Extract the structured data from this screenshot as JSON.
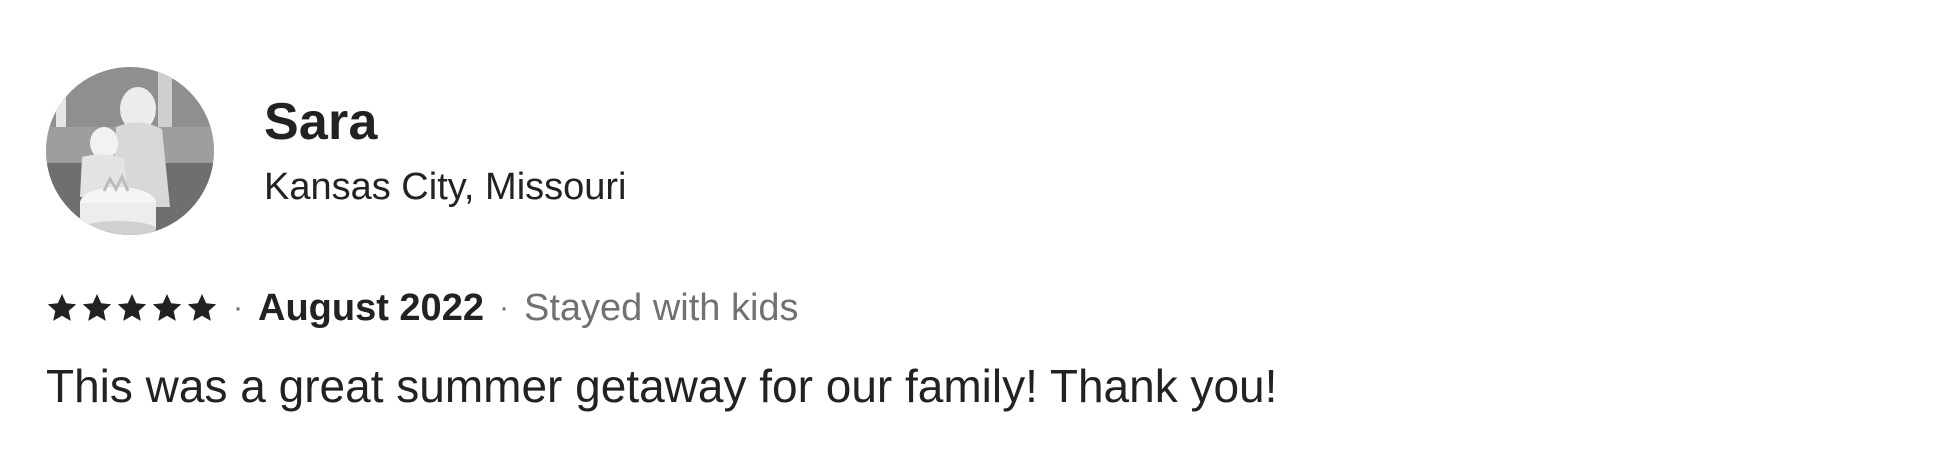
{
  "reviewer": {
    "name": "Sara",
    "location": "Kansas City, Missouri",
    "avatar_icon": "reviewer-photo-avatar"
  },
  "review": {
    "rating": 5,
    "rating_max": 5,
    "star_color": "#222222",
    "separator": "·",
    "date": "August 2022",
    "trip_type": "Stayed with kids",
    "text": "This was a great summer getaway for our family! Thank you!"
  },
  "colors": {
    "primary_text": "#222222",
    "secondary_text": "#717171",
    "background": "#ffffff"
  }
}
